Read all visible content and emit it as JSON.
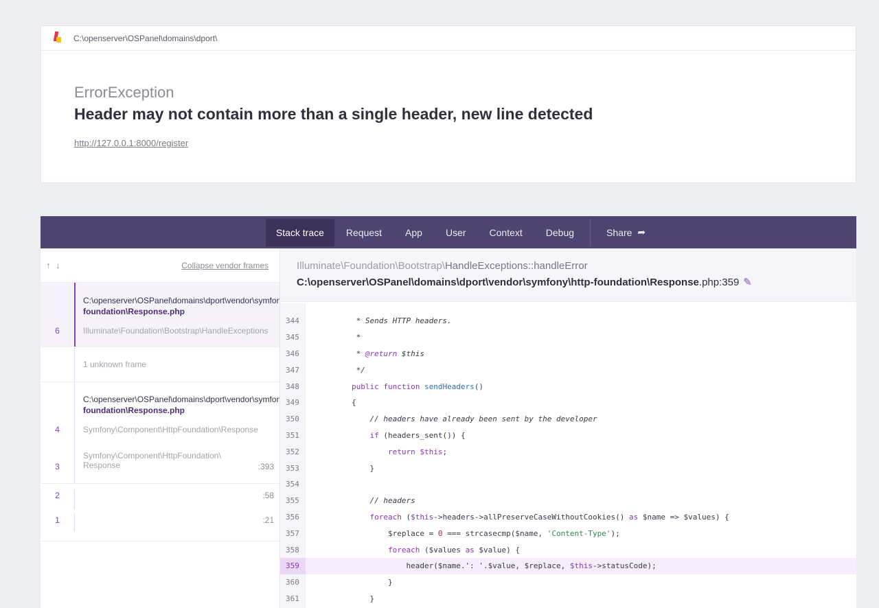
{
  "header": {
    "path": "C:\\openserver\\OSPanel\\domains\\dport\\",
    "exception_class": "ErrorException",
    "message": "Header may not contain more than a single header, new line detected",
    "url": "http://127.0.0.1:8000/register"
  },
  "tabs": {
    "stack_trace": "Stack trace",
    "request": "Request",
    "app": "App",
    "user": "User",
    "context": "Context",
    "debug": "Debug",
    "share": "Share",
    "active": "Stack trace"
  },
  "left": {
    "arrows": "↑ ↓",
    "collapse_label": "Collapse vendor frames",
    "frames": [
      {
        "number": "6",
        "file_path": "C:\\openserver\\OSPanel\\domains\\dport\\vendor\\symfony\\http-",
        "file_name": "foundation\\Response.php",
        "class": "Illuminate\\Foundation\\Bootstrap\\HandleExceptions",
        "line": ""
      },
      {
        "number": "",
        "file_path": "",
        "file_name": "",
        "class": "1 unknown frame",
        "line": ""
      },
      {
        "number": "4",
        "file_path": "C:\\openserver\\OSPanel\\domains\\dport\\vendor\\symfony\\http-",
        "file_name": "foundation\\Response.php",
        "class": "Symfony\\Component\\HttpFoundation\\Response",
        "line": ""
      },
      {
        "number": "3",
        "class_line1": "Symfony\\Component\\HttpFoundation\\",
        "class_line2": "Response",
        "line": ":393"
      },
      {
        "number": "2",
        "line": ":58"
      },
      {
        "number": "1",
        "line": ":21"
      }
    ]
  },
  "right": {
    "method_prefix": "Illuminate\\Foundation\\Bootstrap\\",
    "method_name": "HandleExceptions::handleError",
    "file_path": "C:\\openserver\\OSPanel\\domains\\dport\\vendor\\symfony\\http-foundation\\Response",
    "file_ext_line": ".php:359",
    "highlight_line": 359,
    "code_lines": [
      {
        "n": "344"
      },
      {
        "n": "345"
      },
      {
        "n": "346"
      },
      {
        "n": "347"
      },
      {
        "n": "348"
      },
      {
        "n": "349"
      },
      {
        "n": "350"
      },
      {
        "n": "351"
      },
      {
        "n": "352"
      },
      {
        "n": "353"
      },
      {
        "n": "354"
      },
      {
        "n": "355"
      },
      {
        "n": "356"
      },
      {
        "n": "357"
      },
      {
        "n": "358"
      },
      {
        "n": "359"
      },
      {
        "n": "360"
      },
      {
        "n": "361"
      }
    ],
    "code_text": {
      "l344": "         * Sends HTTP headers.",
      "l345": "         *",
      "l346_a": "         * ",
      "l346_tag": "@return",
      "l346_b": " $this",
      "l347": "         */",
      "l348_kw": "public function ",
      "l348_fn": "sendHeaders",
      "l348_b": "()",
      "l349": "        {",
      "l350": "            // headers have already been sent by the developer",
      "l351_kw": "if",
      "l351_b": " (headers_sent()) {",
      "l352_kw": "return ",
      "l352_var": "$this",
      "l352_b": ";",
      "l353": "            }",
      "l354": "",
      "l355": "            // headers",
      "l356_kw": "foreach",
      "l356_a": " (",
      "l356_var": "$this",
      "l356_b": "->headers->allPreserveCaseWithoutCookies() ",
      "l356_as": "as",
      "l356_c": " $name => $values) {",
      "l357_a": "$replace = ",
      "l357_num": "0",
      "l357_b": " === strcasecmp($name, ",
      "l357_str": "'Content-Type'",
      "l357_c": ");",
      "l358_kw": "foreach",
      "l358_a": " ($values ",
      "l358_as": "as",
      "l358_b": " $value) {",
      "l359_a": "header($name.': '.$value, $replace, ",
      "l359_var": "$this",
      "l359_b": "->statusCode);",
      "l360": "                }",
      "l361": "            }"
    }
  }
}
